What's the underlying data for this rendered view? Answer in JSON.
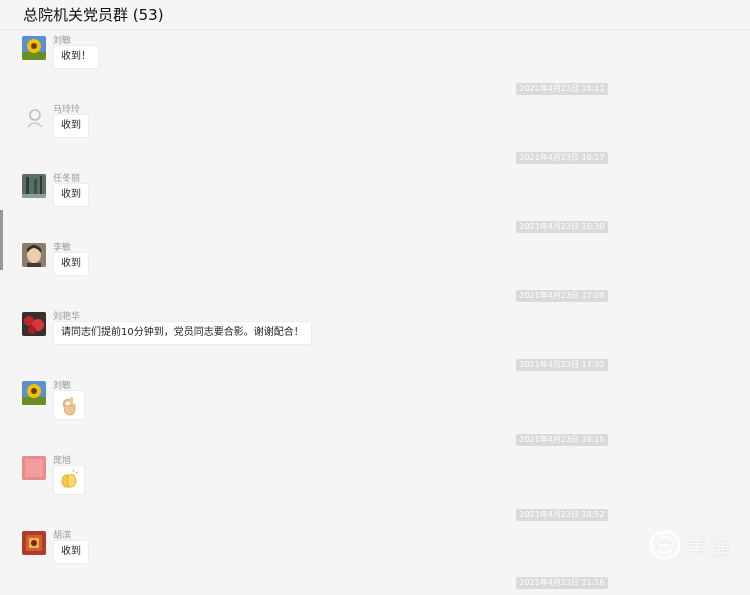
{
  "header": {
    "title": "总院机关党员群 (53)"
  },
  "messages": [
    {
      "sender": "刘敏",
      "text": "收到！",
      "avatar": "sunflower"
    },
    {
      "sender": "马玲玲",
      "text": "收到",
      "avatar": "sketch"
    },
    {
      "sender": "任冬丽",
      "text": "收到",
      "avatar": "forest"
    },
    {
      "sender": "李敏",
      "text": "收到",
      "avatar": "portrait"
    },
    {
      "sender": "刘艳华",
      "text": "请同志们提前10分钟到，党员同志要合影。谢谢配合！",
      "avatar": "flowers"
    },
    {
      "sender": "刘敏",
      "text": "",
      "emoji": "ok-hand",
      "avatar": "sunflower"
    },
    {
      "sender": "庞旭",
      "text": "",
      "emoji": "clapping-hands",
      "avatar": "pink"
    },
    {
      "sender": "胡滨",
      "text": "收到",
      "avatar": "red-art"
    }
  ],
  "timestamps": [
    "2021年4月23日 16:11",
    "2021年4月23日 16:17",
    "2021年4月23日 16:30",
    "2021年4月23日 17:08",
    "2021年4月23日 17:32",
    "2021年4月23日 18:15",
    "2021年4月23日 18:52",
    "2021年4月23日 21:16"
  ],
  "watermark": {
    "text": "美篇"
  },
  "colors": {
    "background": "#f5f5f5",
    "bubble": "#ffffff",
    "timestamp_bg": "#dadada"
  }
}
